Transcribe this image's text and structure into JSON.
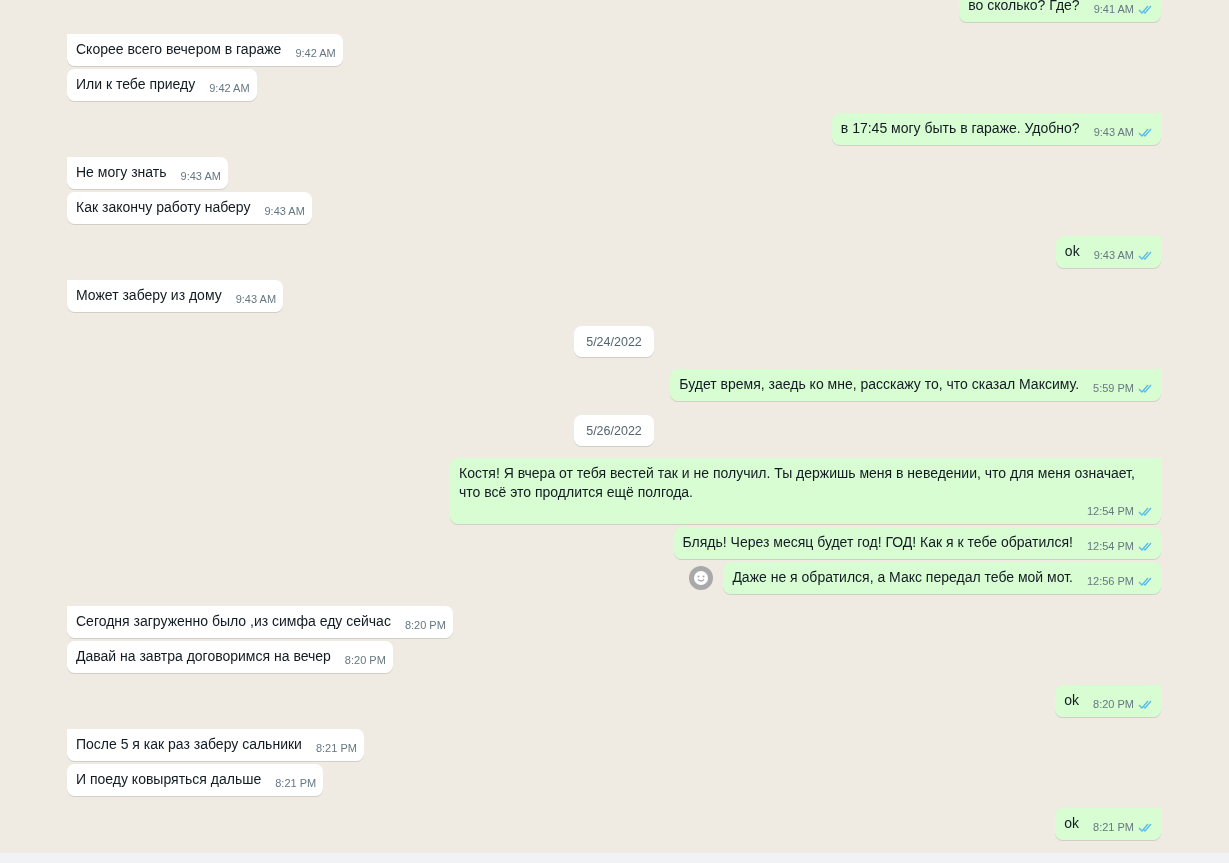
{
  "messages": [
    {
      "kind": "out",
      "first": false,
      "text": "во сколько? Где?",
      "time": "9:41 AM",
      "read": true
    },
    {
      "kind": "in",
      "first": true,
      "text": "Скорее всего вечером в гараже",
      "time": "9:42 AM"
    },
    {
      "kind": "in",
      "first": false,
      "text": "Или к тебе приеду",
      "time": "9:42 AM"
    },
    {
      "kind": "out",
      "first": true,
      "text": "в 17:45 могу быть в гараже. Удобно?",
      "time": "9:43 AM",
      "read": true
    },
    {
      "kind": "in",
      "first": true,
      "text": "Не могу знать",
      "time": "9:43 AM"
    },
    {
      "kind": "in",
      "first": false,
      "text": "Как закончу работу наберу",
      "time": "9:43 AM"
    },
    {
      "kind": "out",
      "first": true,
      "text": "ok",
      "time": "9:43 AM",
      "read": true
    },
    {
      "kind": "in",
      "first": true,
      "text": "Может заберу из дому",
      "time": "9:43 AM"
    },
    {
      "kind": "date",
      "text": "5/24/2022"
    },
    {
      "kind": "out",
      "first": true,
      "text": "Будет время, заедь ко мне, расскажу то, что сказал Максиму.",
      "time": "5:59 PM",
      "read": true
    },
    {
      "kind": "date",
      "text": "5/26/2022"
    },
    {
      "kind": "out",
      "first": true,
      "text": "Костя! Я вчера от тебя вестей так и не получил. Ты держишь меня в неведении, что для меня означает, что всё это продлится ещё полгода.",
      "time": "12:54 PM",
      "read": true
    },
    {
      "kind": "out",
      "first": false,
      "text": "Блядь! Через месяц будет год! ГОД! Как я к тебе обратился!",
      "time": "12:54 PM",
      "read": true
    },
    {
      "kind": "out",
      "first": false,
      "text": "Даже не я обратился, а Макс передал тебе мой мот.",
      "time": "12:56 PM",
      "read": true,
      "reaction_button": true
    },
    {
      "kind": "in",
      "first": true,
      "text": "Сегодня загруженно было ,из симфа еду сейчас",
      "time": "8:20 PM"
    },
    {
      "kind": "in",
      "first": false,
      "text": "Давай на завтра договоримся на вечер",
      "time": "8:20 PM"
    },
    {
      "kind": "out",
      "first": true,
      "text": "ok",
      "time": "8:20 PM",
      "read": true
    },
    {
      "kind": "in",
      "first": true,
      "text": "После 5 я как раз заберу сальники",
      "time": "8:21 PM"
    },
    {
      "kind": "in",
      "first": false,
      "text": "И поеду ковыряться дальше",
      "time": "8:21 PM"
    },
    {
      "kind": "out",
      "first": true,
      "text": "ok",
      "time": "8:21 PM",
      "read": true
    }
  ]
}
